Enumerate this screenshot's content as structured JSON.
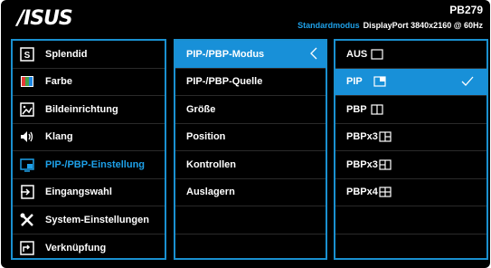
{
  "header": {
    "brand": "/ISUS",
    "model": "PB279",
    "mode": "Standardmodus",
    "signal": "DisplayPort  3840x2160 @ 60Hz"
  },
  "main_menu": [
    {
      "label": "Splendid",
      "icon": "splendid-icon"
    },
    {
      "label": "Farbe",
      "icon": "color-icon"
    },
    {
      "label": "Bildeinrichtung",
      "icon": "image-icon"
    },
    {
      "label": "Klang",
      "icon": "speaker-icon"
    },
    {
      "label": "PIP-/PBP-Einstellung",
      "icon": "pip-icon"
    },
    {
      "label": "Eingangswahl",
      "icon": "input-icon"
    },
    {
      "label": "System-Einstellungen",
      "icon": "tools-icon"
    },
    {
      "label": "Verknüpfung",
      "icon": "shortcut-icon"
    }
  ],
  "submenu": [
    "PIP-/PBP-Modus",
    "PIP-/PBP-Quelle",
    "Größe",
    "Position",
    "Kontrollen",
    "Auslagern"
  ],
  "options": [
    {
      "label": "AUS",
      "icon": "off-icon"
    },
    {
      "label": "PIP",
      "icon": "pip-window-icon"
    },
    {
      "label": "PBP",
      "icon": "pbp-icon"
    },
    {
      "label": "PBPx3",
      "icon": "pbpx3-icon-a"
    },
    {
      "label": "PBPx3",
      "icon": "pbpx3-icon-b"
    },
    {
      "label": "PBPx4",
      "icon": "pbpx4-icon"
    }
  ],
  "colors": {
    "accent": "#1ea0e8",
    "highlight": "#1890d8",
    "border": "#1a90d0"
  }
}
